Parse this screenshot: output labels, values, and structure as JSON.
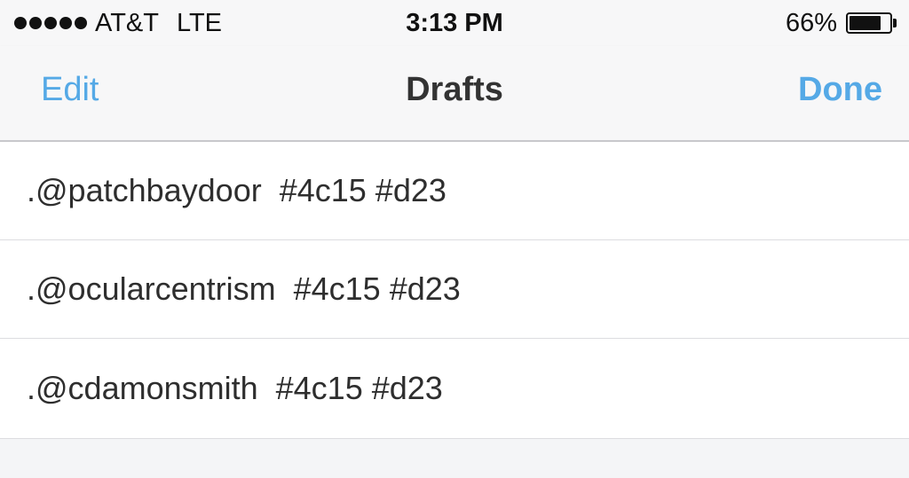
{
  "status_bar": {
    "carrier": "AT&T",
    "network": "LTE",
    "time": "3:13 PM",
    "battery_percent": "66%",
    "battery_level": 0.8,
    "signal_bars": 5
  },
  "nav": {
    "left_label": "Edit",
    "title": "Drafts",
    "right_label": "Done"
  },
  "drafts": [
    {
      "text": ".@patchbaydoor  #4c15 #d23"
    },
    {
      "text": ".@ocularcentrism  #4c15 #d23"
    },
    {
      "text": ".@cdamonsmith  #4c15 #d23"
    }
  ],
  "colors": {
    "accent": "#55a9e6",
    "background": "#f4f5f7",
    "text": "#2e2e2e"
  }
}
